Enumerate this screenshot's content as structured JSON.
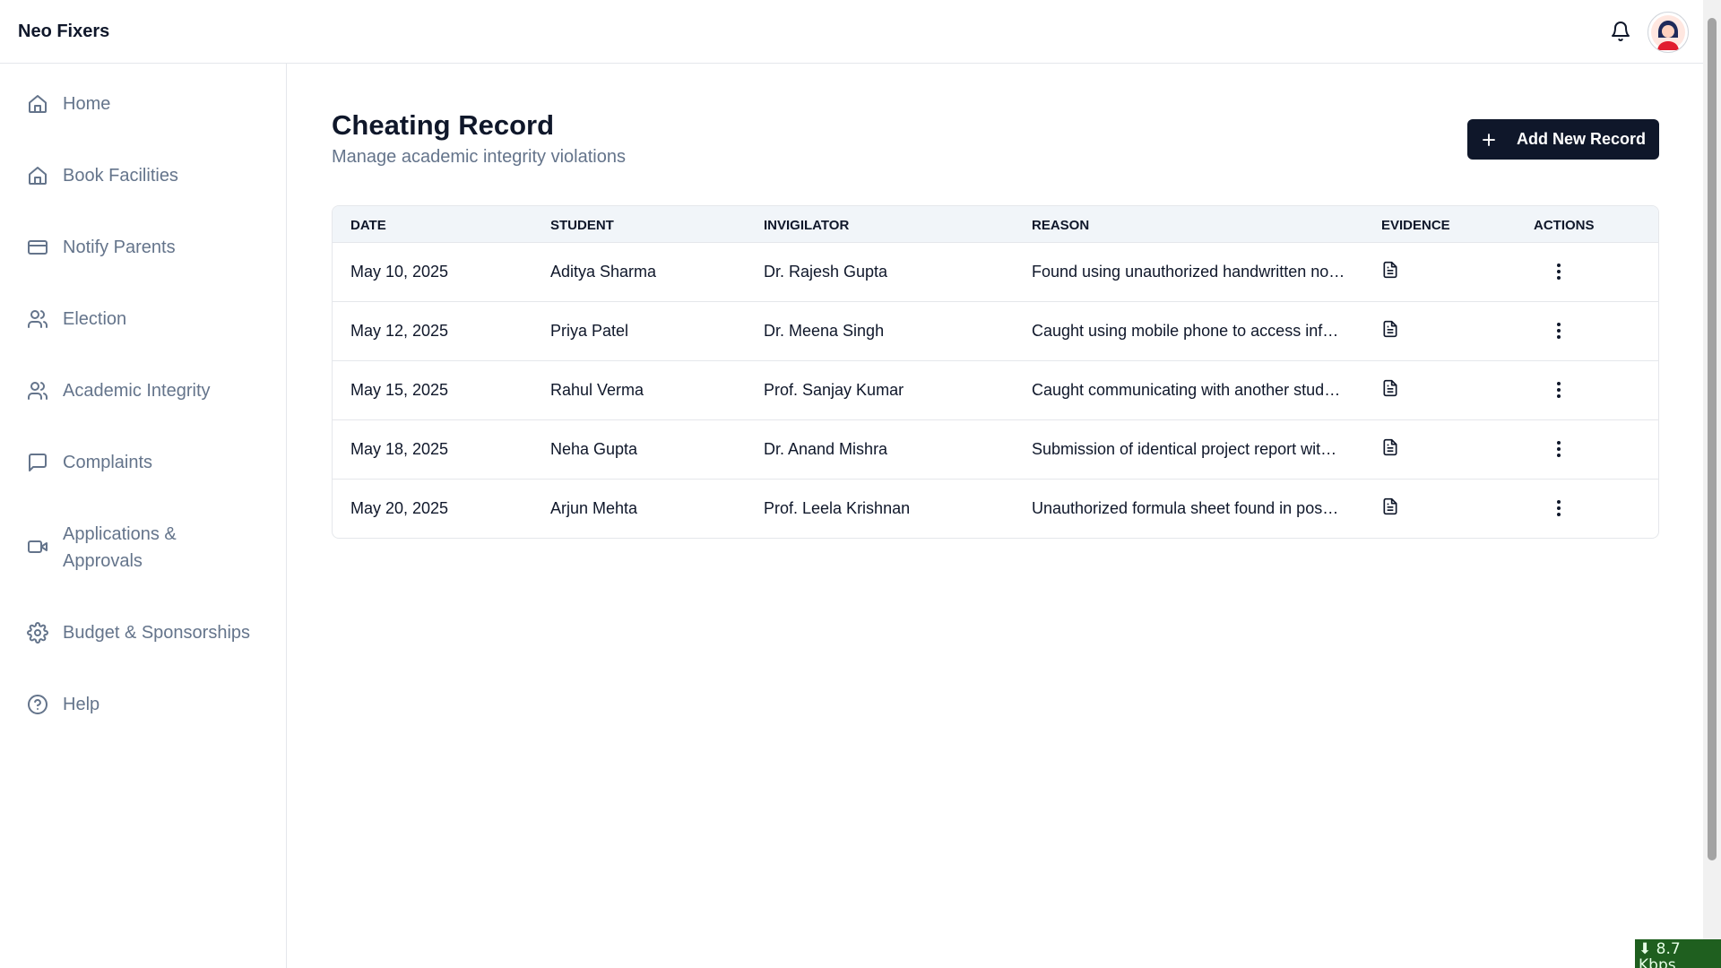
{
  "app": {
    "brand": "Neo Fixers"
  },
  "sidebar": {
    "items": [
      {
        "label": "Home",
        "icon": "home-icon"
      },
      {
        "label": "Book Facilities",
        "icon": "home-icon"
      },
      {
        "label": "Notify Parents",
        "icon": "card-icon"
      },
      {
        "label": "Election",
        "icon": "users-icon"
      },
      {
        "label": "Academic Integrity",
        "icon": "users-icon"
      },
      {
        "label": "Complaints",
        "icon": "message-icon"
      },
      {
        "label": "Applications & Approvals",
        "icon": "video-icon"
      },
      {
        "label": "Budget & Sponsorships",
        "icon": "gear-icon"
      },
      {
        "label": "Help",
        "icon": "help-circle-icon"
      }
    ]
  },
  "page": {
    "title": "Cheating Record",
    "subtitle": "Manage academic integrity violations",
    "add_button_label": "Add New Record"
  },
  "table": {
    "headers": {
      "date": "DATE",
      "student": "STUDENT",
      "invigilator": "INVIGILATOR",
      "reason": "REASON",
      "evidence": "EVIDENCE",
      "actions": "ACTIONS"
    },
    "rows": [
      {
        "date": "May 10, 2025",
        "student": "Aditya Sharma",
        "invigilator": "Dr. Rajesh Gupta",
        "reason": "Found using unauthorized handwritten not..."
      },
      {
        "date": "May 12, 2025",
        "student": "Priya Patel",
        "invigilator": "Dr. Meena Singh",
        "reason": "Caught using mobile phone to access infor..."
      },
      {
        "date": "May 15, 2025",
        "student": "Rahul Verma",
        "invigilator": "Prof. Sanjay Kumar",
        "reason": "Caught communicating with another stude..."
      },
      {
        "date": "May 18, 2025",
        "student": "Neha Gupta",
        "invigilator": "Dr. Anand Mishra",
        "reason": "Submission of identical project report with ..."
      },
      {
        "date": "May 20, 2025",
        "student": "Arjun Mehta",
        "invigilator": "Prof. Leela Krishnan",
        "reason": "Unauthorized formula sheet found in posse..."
      }
    ]
  },
  "overlay": {
    "network_speed": "⬇ 8.7 Kbps"
  },
  "colors": {
    "primary": "#0f172a",
    "muted": "#64748b",
    "border": "#e5e7eb",
    "header_bg": "#f1f5f9"
  }
}
